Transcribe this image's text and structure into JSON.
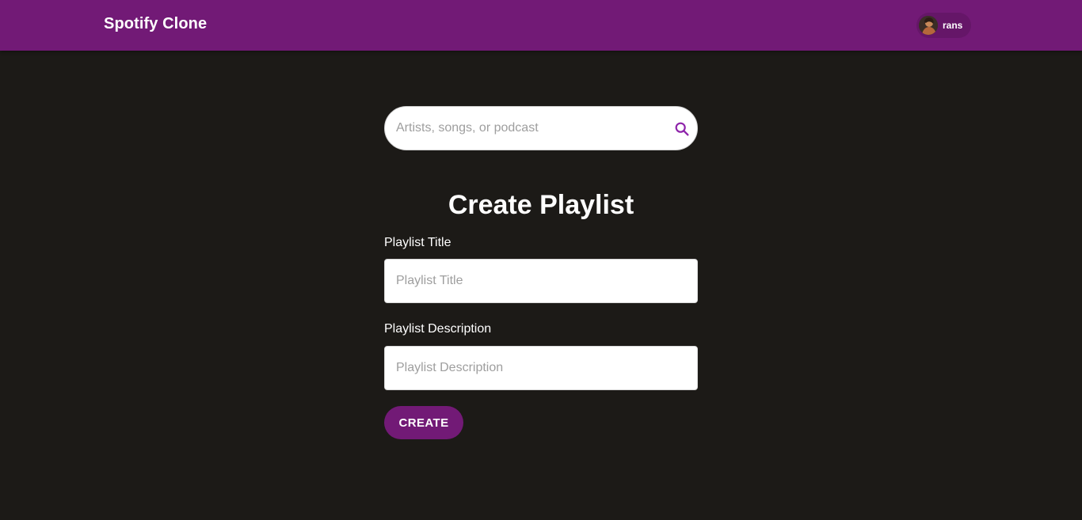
{
  "navbar": {
    "brand": "Spotify Clone",
    "user": {
      "name": "rans",
      "avatar_icon": "user-avatar"
    }
  },
  "search": {
    "placeholder": "Artists, songs, or podcast",
    "value": "",
    "icon": "search-icon"
  },
  "form": {
    "title": "Create Playlist",
    "fields": [
      {
        "label": "Playlist Title",
        "placeholder": "Playlist Title",
        "value": ""
      },
      {
        "label": "Playlist Description",
        "placeholder": "Playlist Description",
        "value": ""
      }
    ],
    "submit_label": "CREATE"
  },
  "colors": {
    "brand": "#721a76",
    "background": "#1c1a17",
    "accent": "#8e24aa"
  }
}
